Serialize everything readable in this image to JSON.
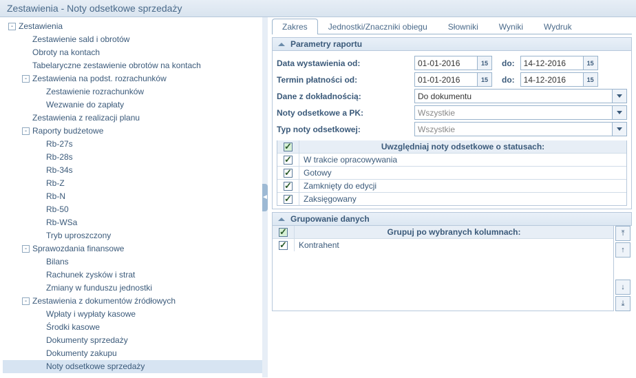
{
  "header": {
    "title": "Zestawienia - Noty odsetkowe sprzedaży"
  },
  "tree": [
    {
      "label": "Zestawienia",
      "lv": 0,
      "exp": "-"
    },
    {
      "label": "Zestawienie sald i obrotów",
      "lv": 1
    },
    {
      "label": "Obroty na kontach",
      "lv": 1
    },
    {
      "label": "Tabelaryczne zestawienie obrotów na kontach",
      "lv": 1
    },
    {
      "label": "Zestawienia na podst. rozrachunków",
      "lv": 1,
      "exp": "-"
    },
    {
      "label": "Zestawienie rozrachunków",
      "lv": 2
    },
    {
      "label": "Wezwanie do zapłaty",
      "lv": 2
    },
    {
      "label": "Zestawienia z realizacji planu",
      "lv": 1
    },
    {
      "label": "Raporty budżetowe",
      "lv": 1,
      "exp": "-"
    },
    {
      "label": "Rb-27s",
      "lv": 2
    },
    {
      "label": "Rb-28s",
      "lv": 2
    },
    {
      "label": "Rb-34s",
      "lv": 2
    },
    {
      "label": "Rb-Z",
      "lv": 2
    },
    {
      "label": "Rb-N",
      "lv": 2
    },
    {
      "label": "Rb-50",
      "lv": 2
    },
    {
      "label": "Rb-WSa",
      "lv": 2
    },
    {
      "label": "Tryb uproszczony",
      "lv": 2
    },
    {
      "label": "Sprawozdania finansowe",
      "lv": 1,
      "exp": "-"
    },
    {
      "label": "Bilans",
      "lv": 2
    },
    {
      "label": "Rachunek zysków i strat",
      "lv": 2
    },
    {
      "label": "Zmiany w funduszu jednostki",
      "lv": 2
    },
    {
      "label": "Zestawienia z dokumentów źródłowych",
      "lv": 1,
      "exp": "-"
    },
    {
      "label": "Wpłaty i wypłaty kasowe",
      "lv": 2
    },
    {
      "label": "Środki kasowe",
      "lv": 2
    },
    {
      "label": "Dokumenty sprzedaży",
      "lv": 2
    },
    {
      "label": "Dokumenty zakupu",
      "lv": 2
    },
    {
      "label": "Noty odsetkowe sprzedaży",
      "lv": 2,
      "selected": true
    }
  ],
  "tabs": [
    {
      "label": "Zakres",
      "active": true
    },
    {
      "label": "Jednostki/Znaczniki obiegu"
    },
    {
      "label": "Słowniki"
    },
    {
      "label": "Wyniki"
    },
    {
      "label": "Wydruk"
    }
  ],
  "sections": {
    "params_title": "Parametry raportu",
    "group_title": "Grupowanie danych"
  },
  "fields": {
    "date_issue_label": "Data wystawienia od:",
    "date_issue_from": "01-01-2016",
    "date_issue_to_lbl": "do:",
    "date_issue_to": "14-12-2016",
    "paydate_label": "Termin płatności od:",
    "paydate_from": "01-01-2016",
    "paydate_to_lbl": "do:",
    "paydate_to": "14-12-2016",
    "precision_label": "Dane z dokładnością:",
    "precision_value": "Do dokumentu",
    "notes_pk_label": "Noty odsetkowe a PK:",
    "notes_pk_value": "Wszystkie",
    "note_type_label": "Typ noty odsetkowej:",
    "note_type_value": "Wszystkie"
  },
  "status_grid": {
    "header": "Uwzględniaj noty odsetkowe o statusach:",
    "rows": [
      {
        "checked": true,
        "label": "W trakcie opracowywania"
      },
      {
        "checked": true,
        "label": "Gotowy"
      },
      {
        "checked": true,
        "label": "Zamknięty do edycji"
      },
      {
        "checked": true,
        "label": "Zaksięgowany"
      }
    ]
  },
  "group_grid": {
    "header": "Grupuj po wybranych kolumnach:",
    "rows": [
      {
        "checked": true,
        "label": "Kontrahent"
      }
    ]
  },
  "icons": {
    "cal": "15"
  }
}
